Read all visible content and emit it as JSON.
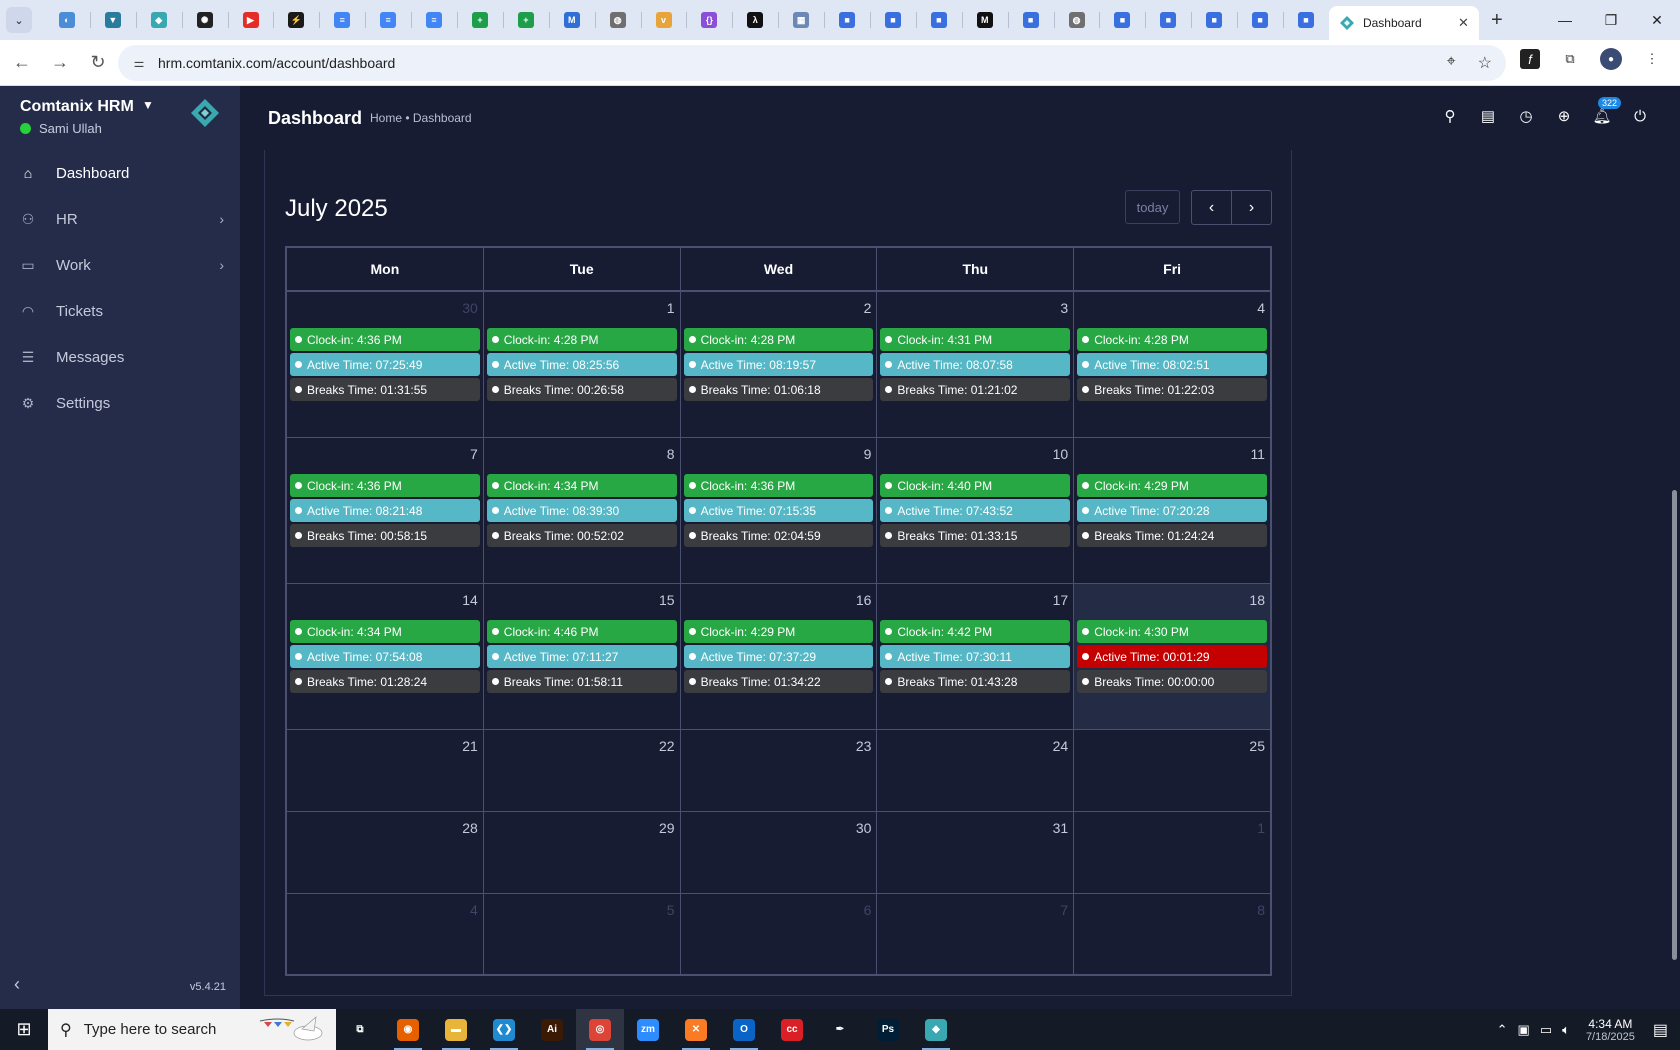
{
  "browser": {
    "pinned_tabs": [
      {
        "icon": "globe-blue-icon",
        "color": "#4a8ed8",
        "glyph": "◐"
      },
      {
        "icon": "vpn-shield-icon",
        "color": "#2a7c9c",
        "glyph": "▼"
      },
      {
        "icon": "comtanix-diamond-icon",
        "color": "#3aa8b0",
        "glyph": "◆"
      },
      {
        "icon": "chatgpt-icon",
        "color": "#222222",
        "glyph": "✺"
      },
      {
        "icon": "youtube-icon",
        "color": "#e52d27",
        "glyph": "▶"
      },
      {
        "icon": "lightning-icon",
        "color": "#1a1a1a",
        "glyph": "⚡"
      },
      {
        "icon": "google-docs-icon",
        "color": "#4285f4",
        "glyph": "≡"
      },
      {
        "icon": "google-docs-icon",
        "color": "#4285f4",
        "glyph": "≡"
      },
      {
        "icon": "google-docs-icon",
        "color": "#4285f4",
        "glyph": "≡"
      },
      {
        "icon": "google-sheets-icon",
        "color": "#1e9e4a",
        "glyph": "+"
      },
      {
        "icon": "google-sheets-icon",
        "color": "#1e9e4a",
        "glyph": "+"
      },
      {
        "icon": "map-icon",
        "color": "#2f6fd6",
        "glyph": "M"
      },
      {
        "icon": "globe-grey-icon",
        "color": "#6f6f6f",
        "glyph": "◍"
      },
      {
        "icon": "fox-icon",
        "color": "#e8a33a",
        "glyph": "v"
      },
      {
        "icon": "code-braces-icon",
        "color": "#8b4fd8",
        "glyph": "{}"
      },
      {
        "icon": "lambda-icon",
        "color": "#111111",
        "glyph": "λ"
      },
      {
        "icon": "grid-icon",
        "color": "#6c88b5",
        "glyph": "▦"
      },
      {
        "icon": "forms-icon",
        "color": "#3a6fe0",
        "glyph": "■"
      },
      {
        "icon": "forms-icon",
        "color": "#3a6fe0",
        "glyph": "■"
      },
      {
        "icon": "forms-icon",
        "color": "#3a6fe0",
        "glyph": "■"
      },
      {
        "icon": "m-logo-icon",
        "color": "#111111",
        "glyph": "M"
      },
      {
        "icon": "forms-icon",
        "color": "#3a6fe0",
        "glyph": "■"
      },
      {
        "icon": "globe-grey-icon",
        "color": "#6f6f6f",
        "glyph": "◍"
      },
      {
        "icon": "forms-icon",
        "color": "#3a6fe0",
        "glyph": "■"
      },
      {
        "icon": "forms-icon",
        "color": "#3a6fe0",
        "glyph": "■"
      },
      {
        "icon": "forms-icon",
        "color": "#3a6fe0",
        "glyph": "■"
      },
      {
        "icon": "forms-icon",
        "color": "#3a6fe0",
        "glyph": "■"
      },
      {
        "icon": "forms-icon",
        "color": "#3a6fe0",
        "glyph": "■"
      }
    ],
    "active_tab_title": "Dashboard",
    "url": "hrm.comtanix.com/account/dashboard"
  },
  "sidebar": {
    "brand": "Comtanix HRM",
    "user": "Sami Ullah",
    "version": "v5.4.21",
    "items": [
      {
        "label": "Dashboard",
        "icon": "home-icon",
        "glyph": "⌂",
        "has_arrow": false,
        "active": true
      },
      {
        "label": "HR",
        "icon": "users-icon",
        "glyph": "⚇",
        "has_arrow": true,
        "active": false
      },
      {
        "label": "Work",
        "icon": "briefcase-icon",
        "glyph": "▭",
        "has_arrow": true,
        "active": false
      },
      {
        "label": "Tickets",
        "icon": "headset-icon",
        "glyph": "◠",
        "has_arrow": false,
        "active": false
      },
      {
        "label": "Messages",
        "icon": "message-icon",
        "glyph": "☰",
        "has_arrow": false,
        "active": false
      },
      {
        "label": "Settings",
        "icon": "gear-icon",
        "glyph": "⚙",
        "has_arrow": false,
        "active": false
      }
    ]
  },
  "header": {
    "title": "Dashboard",
    "breadcrumb": "Home • Dashboard",
    "notification_count": "322"
  },
  "calendar": {
    "title": "July 2025",
    "today_label": "today",
    "weekdays": [
      "Mon",
      "Tue",
      "Wed",
      "Thu",
      "Fri"
    ],
    "weeks": [
      {
        "size": "tall",
        "days": [
          {
            "num": "30",
            "muted": true,
            "clockin": "Clock-in: 4:36 PM",
            "active": "Active Time: 07:25:49",
            "breaks": "Breaks Time: 01:31:55"
          },
          {
            "num": "1",
            "clockin": "Clock-in: 4:28 PM",
            "active": "Active Time: 08:25:56",
            "breaks": "Breaks Time: 00:26:58"
          },
          {
            "num": "2",
            "clockin": "Clock-in: 4:28 PM",
            "active": "Active Time: 08:19:57",
            "breaks": "Breaks Time: 01:06:18"
          },
          {
            "num": "3",
            "clockin": "Clock-in: 4:31 PM",
            "active": "Active Time: 08:07:58",
            "breaks": "Breaks Time: 01:21:02"
          },
          {
            "num": "4",
            "clockin": "Clock-in: 4:28 PM",
            "active": "Active Time: 08:02:51",
            "breaks": "Breaks Time: 01:22:03"
          }
        ]
      },
      {
        "size": "tall",
        "days": [
          {
            "num": "7",
            "clockin": "Clock-in: 4:36 PM",
            "active": "Active Time: 08:21:48",
            "breaks": "Breaks Time: 00:58:15"
          },
          {
            "num": "8",
            "clockin": "Clock-in: 4:34 PM",
            "active": "Active Time: 08:39:30",
            "breaks": "Breaks Time: 00:52:02"
          },
          {
            "num": "9",
            "clockin": "Clock-in: 4:36 PM",
            "active": "Active Time: 07:15:35",
            "breaks": "Breaks Time: 02:04:59"
          },
          {
            "num": "10",
            "clockin": "Clock-in: 4:40 PM",
            "active": "Active Time: 07:43:52",
            "breaks": "Breaks Time: 01:33:15"
          },
          {
            "num": "11",
            "clockin": "Clock-in: 4:29 PM",
            "active": "Active Time: 07:20:28",
            "breaks": "Breaks Time: 01:24:24"
          }
        ]
      },
      {
        "size": "tall",
        "days": [
          {
            "num": "14",
            "clockin": "Clock-in: 4:34 PM",
            "active": "Active Time: 07:54:08",
            "breaks": "Breaks Time: 01:28:24"
          },
          {
            "num": "15",
            "clockin": "Clock-in: 4:46 PM",
            "active": "Active Time: 07:11:27",
            "breaks": "Breaks Time: 01:58:11"
          },
          {
            "num": "16",
            "clockin": "Clock-in: 4:29 PM",
            "active": "Active Time: 07:37:29",
            "breaks": "Breaks Time: 01:34:22"
          },
          {
            "num": "17",
            "clockin": "Clock-in: 4:42 PM",
            "active": "Active Time: 07:30:11",
            "breaks": "Breaks Time: 01:43:28"
          },
          {
            "num": "18",
            "today": true,
            "active_alert": true,
            "clockin": "Clock-in: 4:30 PM",
            "active": "Active Time: 00:01:29",
            "breaks": "Breaks Time: 00:00:00"
          }
        ]
      },
      {
        "size": "short",
        "days": [
          {
            "num": "21"
          },
          {
            "num": "22"
          },
          {
            "num": "23"
          },
          {
            "num": "24"
          },
          {
            "num": "25"
          }
        ]
      },
      {
        "size": "short",
        "days": [
          {
            "num": "28"
          },
          {
            "num": "29"
          },
          {
            "num": "30"
          },
          {
            "num": "31"
          },
          {
            "num": "1",
            "muted": true
          }
        ]
      },
      {
        "size": "short",
        "days": [
          {
            "num": "4",
            "muted": true
          },
          {
            "num": "5",
            "muted": true
          },
          {
            "num": "6",
            "muted": true
          },
          {
            "num": "7",
            "muted": true
          },
          {
            "num": "8",
            "muted": true
          }
        ]
      }
    ]
  },
  "taskbar": {
    "search_placeholder": "Type here to search",
    "apps": [
      {
        "name": "task-view-icon",
        "color": "transparent",
        "glyph": "⧉",
        "running": false
      },
      {
        "name": "firefox-icon",
        "color": "#e66000",
        "glyph": "◉",
        "running": true
      },
      {
        "name": "file-explorer-icon",
        "color": "#e8b43a",
        "glyph": "▬",
        "running": true
      },
      {
        "name": "vscode-icon",
        "color": "#1f8ad2",
        "glyph": "❮❯",
        "running": true
      },
      {
        "name": "illustrator-icon",
        "color": "#3b1a05",
        "glyph": "Ai",
        "running": false
      },
      {
        "name": "chrome-icon",
        "color": "#db4437",
        "glyph": "◎",
        "running": true,
        "focused": true
      },
      {
        "name": "zoom-icon",
        "color": "#2d8cff",
        "glyph": "zm",
        "running": false
      },
      {
        "name": "xampp-icon",
        "color": "#fb7a24",
        "glyph": "✕",
        "running": true
      },
      {
        "name": "outlook-icon",
        "color": "#0a64c8",
        "glyph": "O",
        "running": true
      },
      {
        "name": "creative-cloud-icon",
        "color": "#da1f26",
        "glyph": "cc",
        "running": false
      },
      {
        "name": "pen-tool-icon",
        "color": "transparent",
        "glyph": "✒",
        "running": false
      },
      {
        "name": "photoshop-icon",
        "color": "#001e36",
        "glyph": "Ps",
        "running": false
      },
      {
        "name": "comtanix-app-icon",
        "color": "#3aa8b0",
        "glyph": "◆",
        "running": true
      }
    ],
    "time": "4:34 AM",
    "date": "7/18/2025"
  }
}
